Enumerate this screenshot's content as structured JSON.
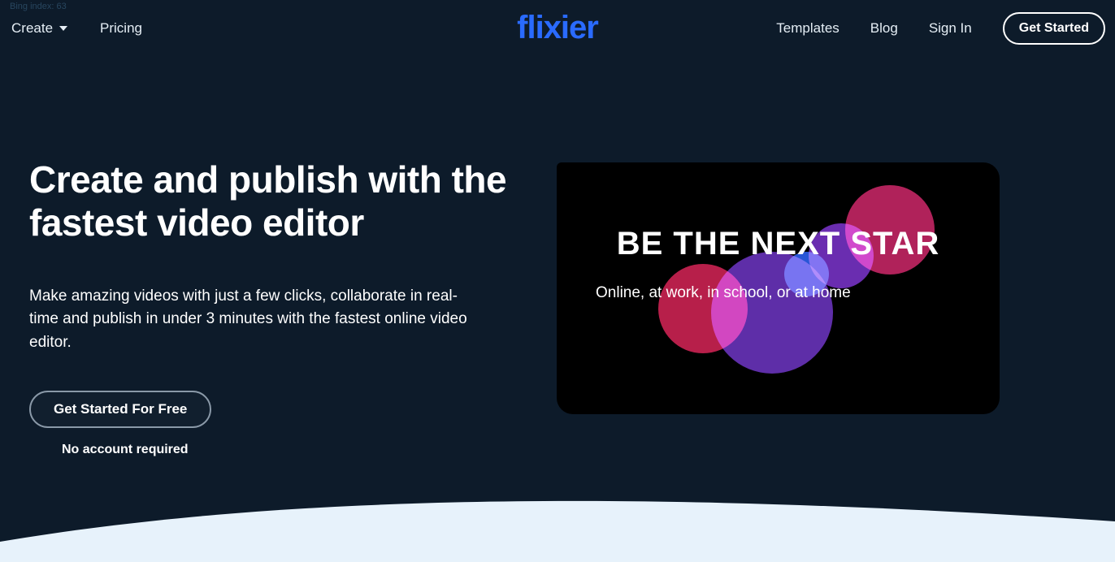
{
  "meta": {
    "bing_index": "Bing index: 63"
  },
  "nav": {
    "create": "Create",
    "pricing": "Pricing",
    "templates": "Templates",
    "blog": "Blog",
    "signin": "Sign In",
    "get_started": "Get Started"
  },
  "logo": "flixier",
  "hero": {
    "title": "Create and publish with the fastest video editor",
    "subtitle": "Make amazing videos with just a few clicks, collaborate in real-time and publish in under 3 minutes with the fastest online video editor.",
    "cta": "Get Started For Free",
    "no_account": "No account required"
  },
  "preview": {
    "title": "BE THE NEXT STAR",
    "subtitle": "Online, at work, in school, or at home"
  }
}
